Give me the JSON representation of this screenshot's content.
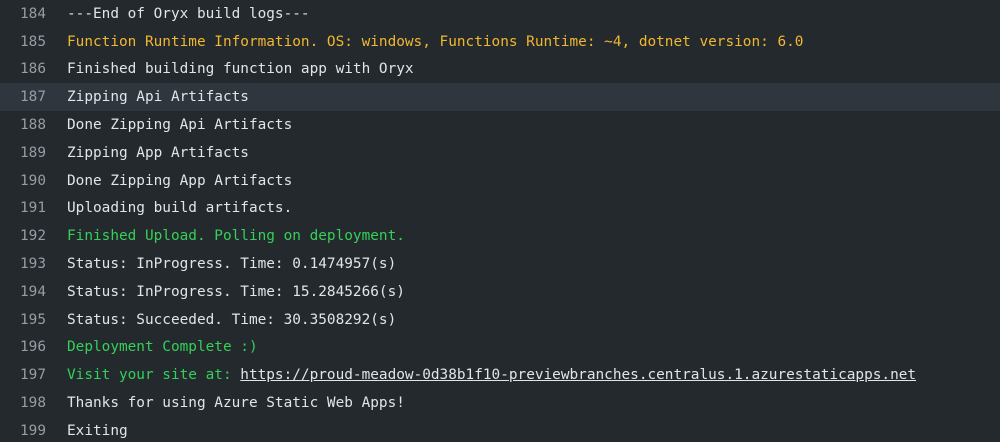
{
  "colors": {
    "background": "#24292e",
    "highlight": "#2f363d",
    "default_text": "#e1e4e8",
    "line_number": "#959da5",
    "warning": "#f0b72f",
    "success": "#34d058"
  },
  "lines": [
    {
      "num": "184",
      "text": "---End of Oryx build logs---"
    },
    {
      "num": "185",
      "text": "Function Runtime Information. OS: windows, Functions Runtime: ~4, dotnet version: 6.0"
    },
    {
      "num": "186",
      "text": "Finished building function app with Oryx"
    },
    {
      "num": "187",
      "text": "Zipping Api Artifacts"
    },
    {
      "num": "188",
      "text": "Done Zipping Api Artifacts"
    },
    {
      "num": "189",
      "text": "Zipping App Artifacts"
    },
    {
      "num": "190",
      "text": "Done Zipping App Artifacts"
    },
    {
      "num": "191",
      "text": "Uploading build artifacts."
    },
    {
      "num": "192",
      "text": "Finished Upload. Polling on deployment."
    },
    {
      "num": "193",
      "text": "Status: InProgress. Time: 0.1474957(s)"
    },
    {
      "num": "194",
      "text": "Status: InProgress. Time: 15.2845266(s)"
    },
    {
      "num": "195",
      "text": "Status: Succeeded. Time: 30.3508292(s)"
    },
    {
      "num": "196",
      "text": "Deployment Complete :)"
    },
    {
      "num": "197",
      "text": "Visit your site at: ",
      "link": "https://proud-meadow-0d38b1f10-previewbranches.centralus.1.azurestaticapps.net"
    },
    {
      "num": "198",
      "text": "Thanks for using Azure Static Web Apps!"
    },
    {
      "num": "199",
      "text": "Exiting"
    }
  ]
}
